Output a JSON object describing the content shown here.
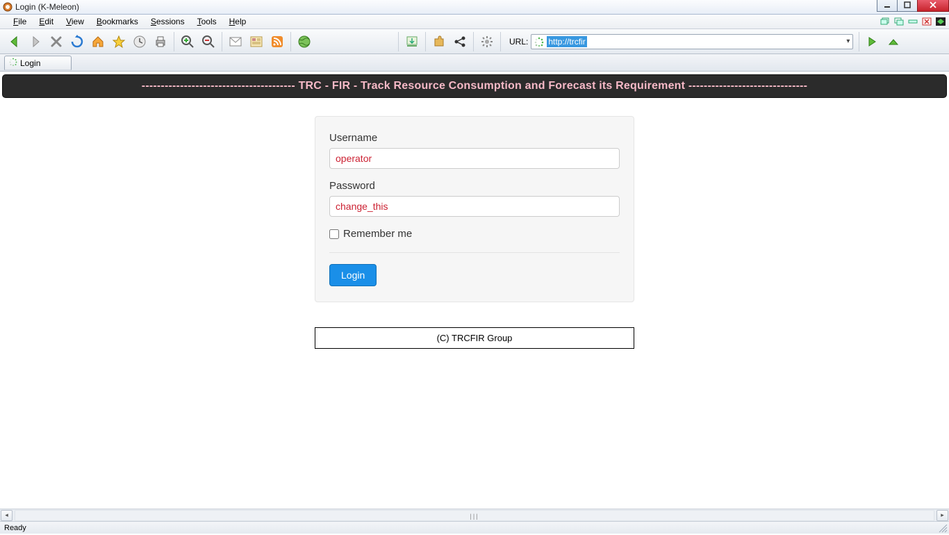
{
  "window": {
    "title": "Login (K-Meleon)"
  },
  "menu": {
    "items": [
      "File",
      "Edit",
      "View",
      "Bookmarks",
      "Sessions",
      "Tools",
      "Help"
    ]
  },
  "url": {
    "label": "URL:",
    "value": "http://trcfir"
  },
  "tab": {
    "label": "Login"
  },
  "banner": {
    "text": "---------------------------------------- TRC - FIR - Track Resource Consumption and Forecast its Requirement -------------------------------"
  },
  "form": {
    "username_label": "Username",
    "username_value": "operator",
    "password_label": "Password",
    "password_value": "change_this",
    "remember_label": "Remember me",
    "login_label": "Login"
  },
  "footer": {
    "text": "(C) TRCFIR Group"
  },
  "status": {
    "text": "Ready"
  }
}
